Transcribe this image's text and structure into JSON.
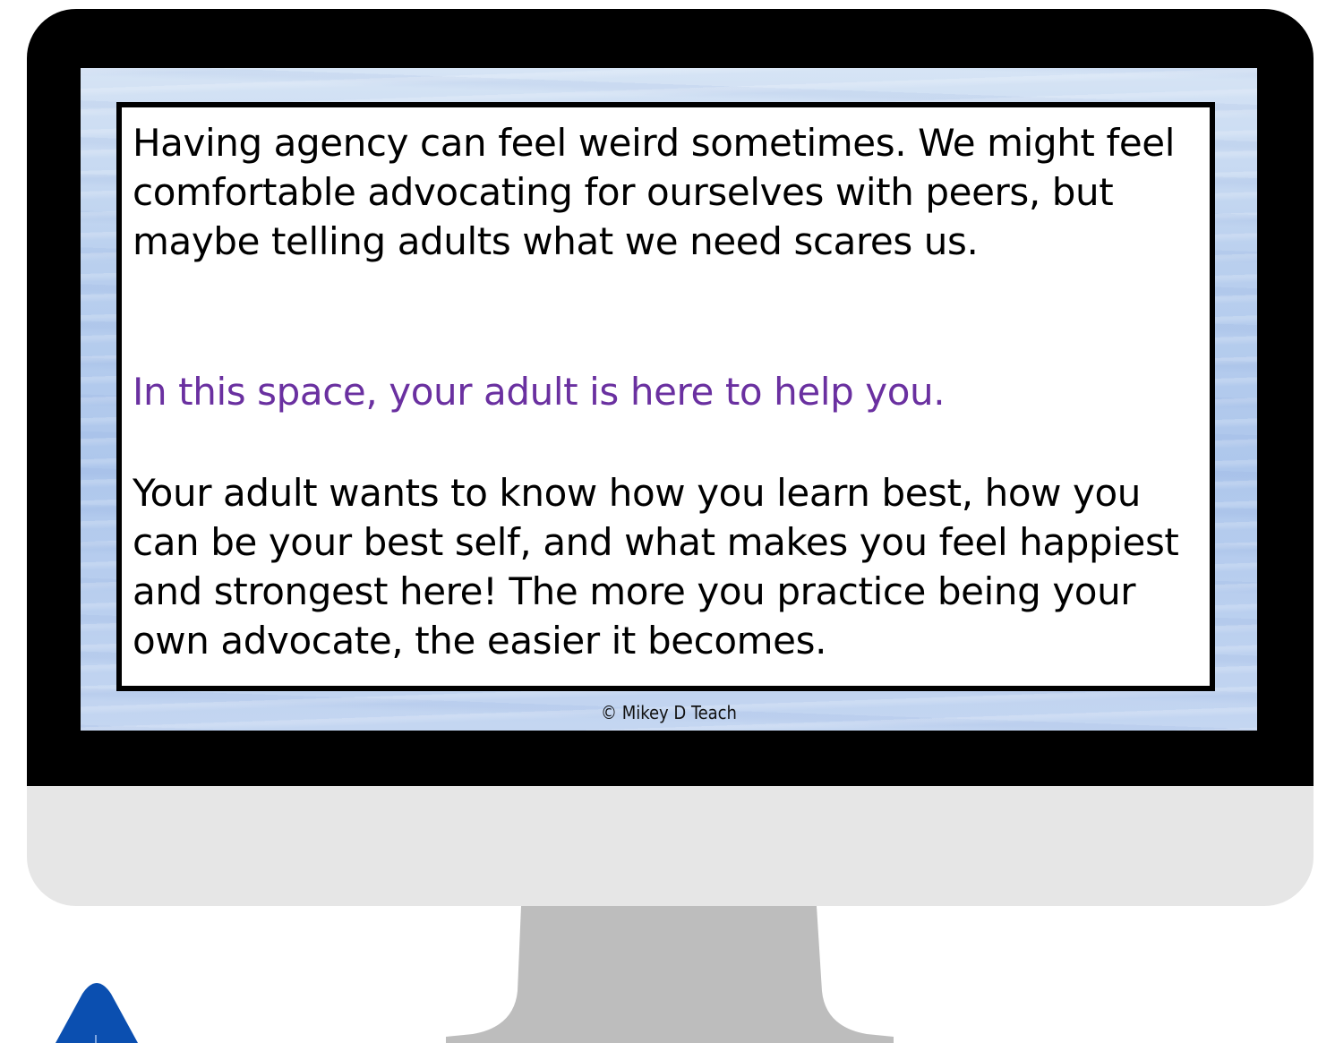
{
  "slide": {
    "paragraph_1": "Having agency can feel weird sometimes. We might feel comfortable advocating for ourselves with peers, but maybe telling adults what we need scares us.",
    "paragraph_2": "In this space, your adult is here to help you.",
    "paragraph_3": "Your adult wants to know how you learn best, how you can be your best self, and what makes you feel happiest and strongest here! The more you practice being your own advocate, the easier it becomes.",
    "credit": "© Mikey D Teach"
  },
  "colors": {
    "bezel": "#000000",
    "monitor_chin": "#e6e6e6",
    "stand": "#bdbdbd",
    "highlight_text": "#6a30a0",
    "logo_blue": "#0b4fb0"
  }
}
